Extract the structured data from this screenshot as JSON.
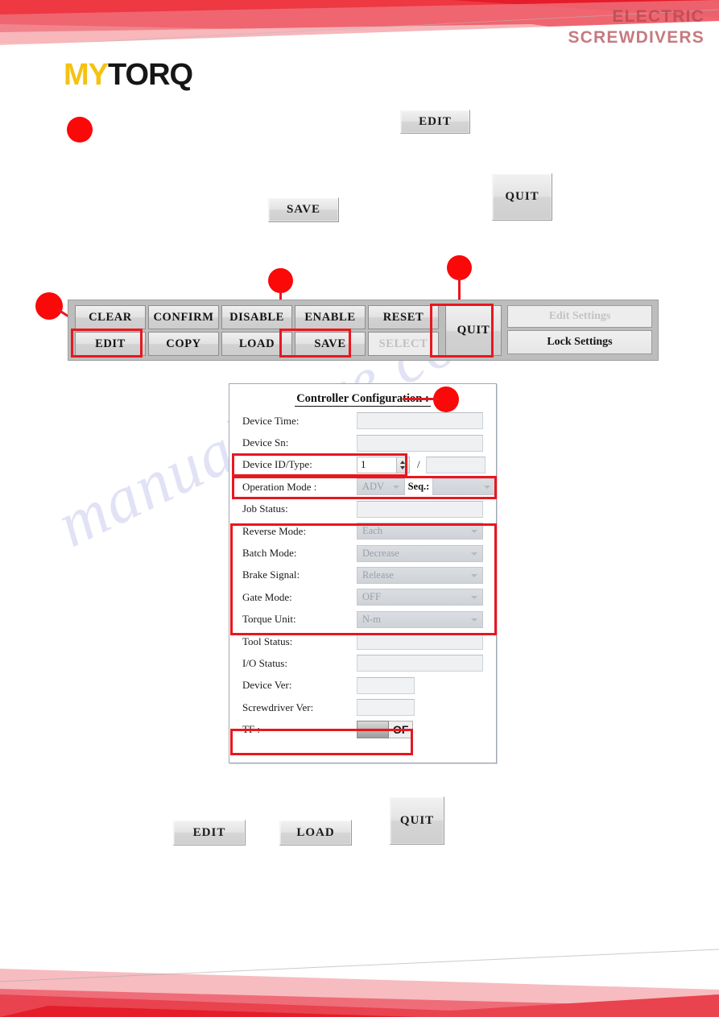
{
  "header": {
    "line1": "ELECTRIC",
    "line2": "SCREWDIVERS",
    "logo_my": "MY",
    "logo_torq": "TORQ",
    "accent_red": "#e8171f",
    "accent_yellow": "#f5c211"
  },
  "watermark": {
    "text": "manualshive.com"
  },
  "top_buttons": {
    "edit": "EDIT",
    "save": "SAVE",
    "quit": "QUIT"
  },
  "toolbar": {
    "row1": [
      "CLEAR",
      "CONFIRM",
      "DISABLE",
      "ENABLE",
      "RESET"
    ],
    "row2": [
      "EDIT",
      "COPY",
      "LOAD",
      "SAVE",
      "SELECT"
    ],
    "quit": "QUIT",
    "edit_settings": "Edit Settings",
    "lock_settings": "Lock Settings"
  },
  "dialog": {
    "title": "Controller Configuration :",
    "rows": [
      {
        "label": "Device Time:",
        "value": ""
      },
      {
        "label": "Device Sn:",
        "value": ""
      },
      {
        "label": "Device ID/Type:",
        "value": "1",
        "separator": "/"
      },
      {
        "label": "Operation Mode :",
        "value": "ADV",
        "seq_label": "Seq.:",
        "seq_value": ""
      },
      {
        "label": "Job Status:",
        "value": ""
      },
      {
        "label": "Reverse Mode:",
        "value": "Each"
      },
      {
        "label": "Batch Mode:",
        "value": "Decrease"
      },
      {
        "label": "Brake Signal:",
        "value": "Release"
      },
      {
        "label": "Gate Mode:",
        "value": "OFF"
      },
      {
        "label": "Torque Unit:",
        "value": "N-m"
      },
      {
        "label": "Tool Status:",
        "value": ""
      },
      {
        "label": "I/O Status:",
        "value": ""
      },
      {
        "label": "Device Ver:",
        "value": ""
      },
      {
        "label": "Screwdriver Ver:",
        "value": ""
      },
      {
        "label": "TF :",
        "value": "OF"
      }
    ]
  },
  "bottom_buttons": {
    "edit": "EDIT",
    "load": "LOAD",
    "quit": "QUIT"
  }
}
